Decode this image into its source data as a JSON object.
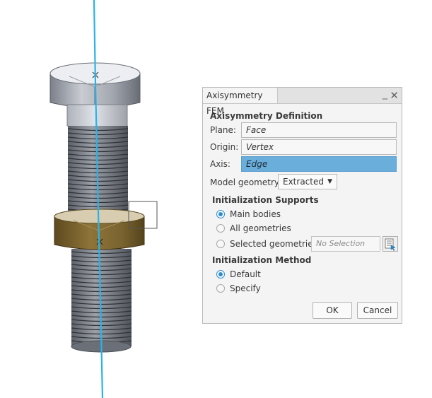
{
  "dialog": {
    "title": "Axisymmetry FEM",
    "minimize_glyph": "_",
    "close_glyph": "✕",
    "axisymmetry_definition": {
      "heading": "Axisymmetry Definition",
      "plane": {
        "label": "Plane:",
        "value": "Face"
      },
      "origin": {
        "label": "Origin:",
        "value": "Vertex"
      },
      "axis": {
        "label": "Axis:",
        "value": "Edge"
      },
      "model_geometry": {
        "label": "Model geometry:",
        "value": "Extracted"
      }
    },
    "initialization_supports": {
      "heading": "Initialization Supports",
      "options": [
        "Main bodies",
        "All geometries",
        "Selected geometries:"
      ],
      "selected_index": 0,
      "selection_placeholder": "No Selection"
    },
    "initialization_method": {
      "heading": "Initialization Method",
      "options": [
        "Default",
        "Specify"
      ],
      "selected_index": 0
    },
    "ok_label": "OK",
    "cancel_label": "Cancel"
  },
  "colors": {
    "axis_line": "#29b3ea",
    "nut": "#7e6530",
    "bolt": "#9ea3ad",
    "active_field": "#6aaedc",
    "radio_checked": "#2f8bd0"
  },
  "icons": [
    "minimize-icon",
    "close-icon",
    "selection-list-icon",
    "origin-marker-icon"
  ]
}
